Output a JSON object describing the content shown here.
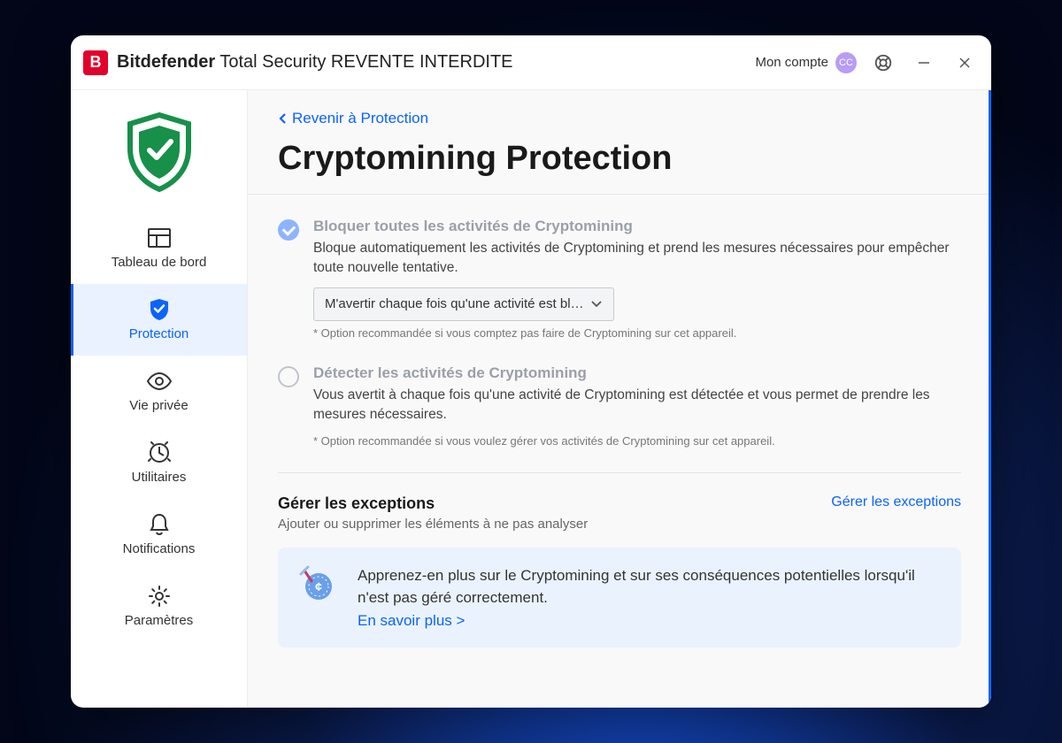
{
  "titlebar": {
    "brand_bold": "Bitdefender",
    "product": " Total Security REVENTE INTERDITE",
    "account_label": "Mon compte",
    "avatar_initials": "CC"
  },
  "sidebar": {
    "items": [
      {
        "label": "Tableau de bord"
      },
      {
        "label": "Protection"
      },
      {
        "label": "Vie privée"
      },
      {
        "label": "Utilitaires"
      },
      {
        "label": "Notifications"
      },
      {
        "label": "Paramètres"
      }
    ]
  },
  "page": {
    "back_label": "Revenir à Protection",
    "title": "Cryptomining Protection",
    "option_block": {
      "title": "Bloquer toutes les activités de Cryptomining",
      "desc": "Bloque automatiquement les activités de Cryptomining et prend les mesures nécessaires pour empêcher toute nouvelle tentative.",
      "dropdown_value": "M'avertir chaque fois qu'une activité est bl…",
      "footnote": "* Option recommandée si vous comptez pas faire de Cryptomining sur cet appareil."
    },
    "option_detect": {
      "title": "Détecter les activités de Cryptomining",
      "desc": "Vous avertit à chaque fois qu'une activité de Cryptomining est détectée et vous permet de prendre les mesures nécessaires.",
      "footnote": "* Option recommandée si vous voulez gérer vos activités de Cryptomining sur cet appareil."
    },
    "exceptions": {
      "title": "Gérer les exceptions",
      "subtitle": "Ajouter ou supprimer les éléments à ne pas analyser",
      "link": "Gérer les exceptions"
    },
    "banner": {
      "text": "Apprenez-en plus sur le Cryptomining et sur ses conséquences potentielles lorsqu'il n'est pas géré correctement.",
      "link": "En savoir plus >"
    }
  }
}
